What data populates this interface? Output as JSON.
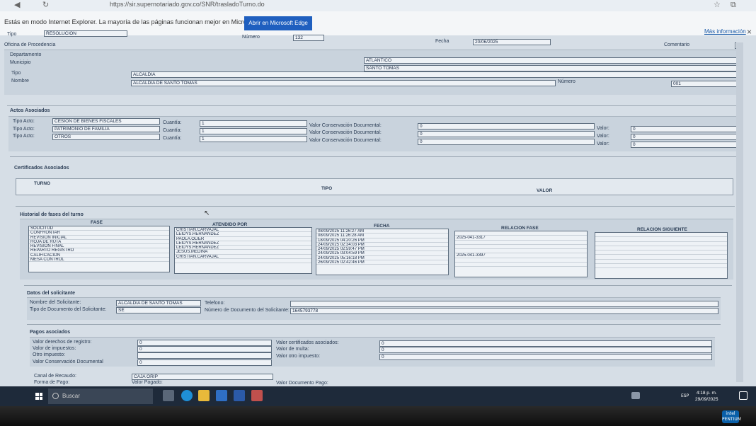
{
  "browser": {
    "url": "https://sir.supernotariado.gov.co/SNR/trasladoTurno.do"
  },
  "ie_banner": {
    "message": "Estás en modo Internet Explorer. La mayoría de las páginas funcionan mejor en Microsoft Edge.",
    "edge_button": "Abrir en Microsoft Edge",
    "more_info": "Más información",
    "close": "×"
  },
  "header": {
    "tipo_label": "Tipo",
    "tipo_value": "RESOLUCION",
    "numero_label": "Número",
    "numero_value": "132",
    "fecha_label": "Fecha",
    "fecha_value": "20/06/2025",
    "comentario_label": "Comentario"
  },
  "procedencia": {
    "title": "Oficina de Procedencia",
    "departamento_label": "Departamento",
    "departamento_value": "ATLANTICO",
    "municipio_label": "Municipio",
    "municipio_value": "SANTO TOMAS",
    "tipo_label": "Tipo",
    "tipo_value": "ALCALDIA",
    "nombre_label": "Nombre",
    "nombre_value": "ALCALDIA DE SANTO TOMAS",
    "numero_label": "Número",
    "numero_value": "001"
  },
  "actos": {
    "title": "Actos Asociados",
    "tipo_label": "Tipo Acto:",
    "cuantia_label": "Cuantía:",
    "vcd_label": "Valor Conservación Documental:",
    "valor_label": "Valor:",
    "rows": [
      {
        "tipo": "CESION DE BIENES FISCALES",
        "cuantia": "1",
        "vcd": "0",
        "valor": "0"
      },
      {
        "tipo": "PATRIMONIO DE FAMILIA",
        "cuantia": "1",
        "vcd": "0",
        "valor": "0"
      },
      {
        "tipo": "OTROS",
        "cuantia": "1",
        "vcd": "0",
        "valor": "0"
      }
    ]
  },
  "certificados": {
    "title": "Certificados Asociados",
    "turno": "TURNO",
    "tipo": "TIPO",
    "valor": "VALOR"
  },
  "historial": {
    "title": "Historial de fases del turno",
    "headers": {
      "fase": "FASE",
      "atendido": "ATENDIDO POR",
      "fecha": "FECHA",
      "relacion_fase": "RELACION FASE",
      "relacion_siguiente": "RELACION SIGUIENTE"
    },
    "fases": [
      "SOLICITUD",
      "CONFRONTAR",
      "REVISION INICIAL",
      "HOJA DE RUTA",
      "REVISION FINAL",
      "REPARTO REGISTRO",
      "CALIFICACION",
      "MESA CONTROL"
    ],
    "atendido": [
      "CRISTIAN.CARVAJAL",
      "LEIDYS.HERNANDEZ",
      "PAOLA.OLIER",
      "LEIDYS.HERNANDEZ",
      "LEIDYS.HERNANDEZ",
      "JESUS.MEDINA",
      "CRISTIAN.CARVAJAL",
      ""
    ],
    "fechas": [
      "08/09/2025 11:26:27 AM",
      "08/09/2025 11:26:28 AM",
      "18/09/2025 04:20:26 PM",
      "24/09/2025 02:34:03 PM",
      "24/09/2025 02:59:47 PM",
      "24/09/2025 03:04:59 PM",
      "24/09/2025 05:16:18 PM",
      "26/09/2025 02:42:46 PM"
    ],
    "relacion_fase": [
      "",
      "2025-041-3317",
      "",
      "",
      "",
      "2025-041-3397",
      "",
      ""
    ],
    "relacion_siguiente": [
      "",
      "",
      "",
      "",
      "",
      "",
      "",
      ""
    ]
  },
  "solicitante": {
    "title": "Datos del solicitante",
    "nombre_label": "Nombre del Solicitante:",
    "nombre_value": "ALCALDIA DE SANTO TOMAS",
    "telefono_label": "Telefono:",
    "tipodoc_label": "Tipo de Documento del Solicitante:",
    "tipodoc_value": "SE",
    "numdoc_label": "Número de Documento del Solicitante:",
    "numdoc_value": "1645793778"
  },
  "pagos": {
    "title": "Pagos asociados",
    "derechos_label": "Valor derechos de registro:",
    "derechos_value": "0",
    "impuestos_label": "Valor de impuestos:",
    "impuestos_value": "0",
    "otro_label": "Otro impuesto:",
    "otro_value": "",
    "vcd_label": "Valor Conservación Documental",
    "vcd_value": "0",
    "certificados_label": "Valor certificados asociados:",
    "certificados_value": "0",
    "multa_label": "Valor de multa:",
    "multa_value": "0",
    "otro_imp_label": "Valor otro impuesto:",
    "otro_imp_value": "0",
    "canal_label": "Canal de Recaudo:",
    "canal_value": "CAJA ORIP",
    "forma_label": "Forma de Pago:",
    "valor_pagado_label": "Valor Pagado:",
    "valor_doc_label": "Valor Documento Pago:"
  },
  "taskbar": {
    "search": "Buscar",
    "time": "4:18 p. m.",
    "date": "29/09/2025",
    "lang": "ESP"
  },
  "bezel": {
    "sticker_top": "intel",
    "sticker_bottom": "PENTIUM"
  }
}
